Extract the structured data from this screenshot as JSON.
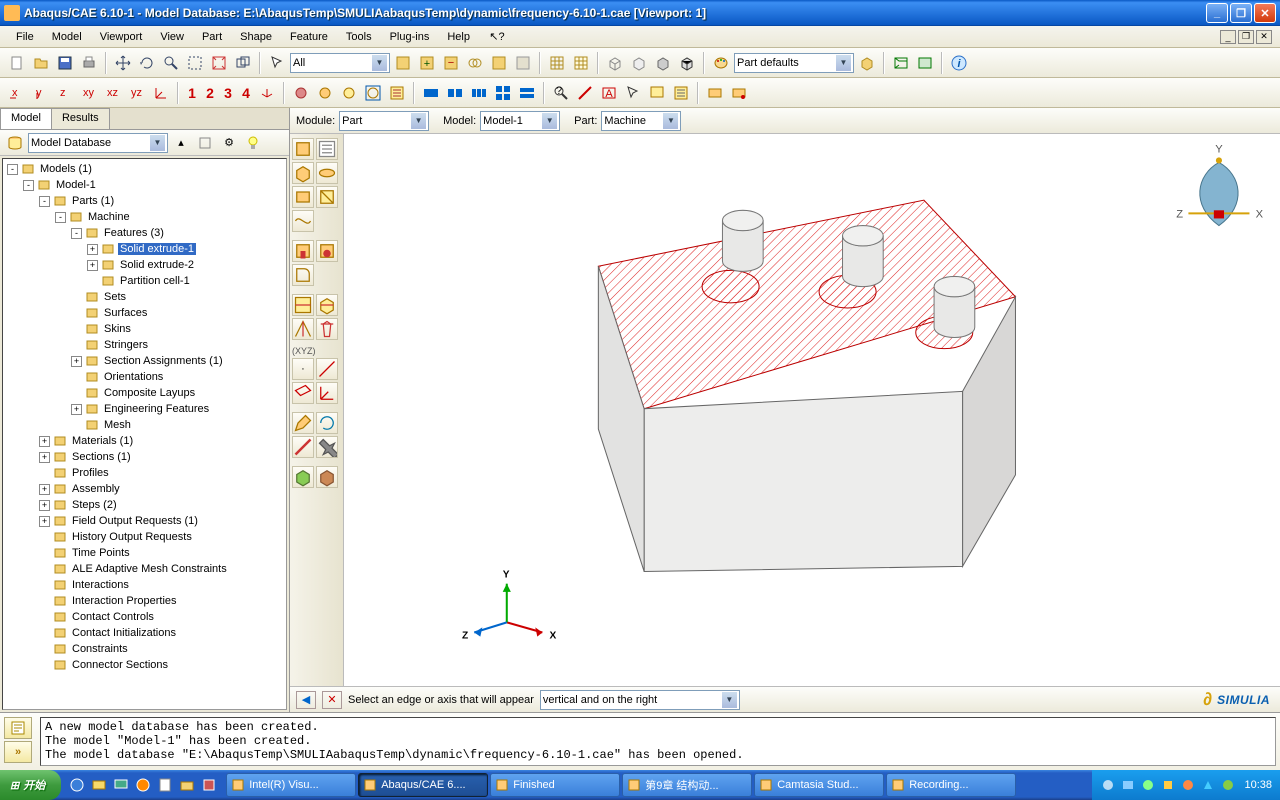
{
  "titlebar": {
    "text": "Abaqus/CAE 6.10-1 - Model Database: E:\\AbaqusTemp\\SMULIAabaqusTemp\\dynamic\\frequency-6.10-1.cae [Viewport: 1]"
  },
  "menubar": {
    "items": [
      "File",
      "Model",
      "Viewport",
      "View",
      "Part",
      "Shape",
      "Feature",
      "Tools",
      "Plug-ins",
      "Help"
    ]
  },
  "toolbar1": {
    "combo": "All",
    "combo2": "Part defaults"
  },
  "toolbar_numbers": [
    "1",
    "2",
    "3",
    "4"
  ],
  "panel_tabs": {
    "model": "Model",
    "results": "Results"
  },
  "panel_combo": "Model Database",
  "context": {
    "module_label": "Module:",
    "module": "Part",
    "model_label": "Model:",
    "model": "Model-1",
    "part_label": "Part:",
    "part": "Machine"
  },
  "tree": [
    {
      "d": 0,
      "e": "-",
      "i": "db",
      "t": "Models (1)"
    },
    {
      "d": 1,
      "e": "-",
      "i": "mdl",
      "t": "Model-1"
    },
    {
      "d": 2,
      "e": "-",
      "i": "parts",
      "t": "Parts (1)"
    },
    {
      "d": 3,
      "e": "-",
      "i": "part",
      "t": "Machine"
    },
    {
      "d": 4,
      "e": "-",
      "i": "feat",
      "t": "Features (3)"
    },
    {
      "d": 5,
      "e": "+",
      "i": "sol",
      "t": "Solid extrude-1",
      "sel": true
    },
    {
      "d": 5,
      "e": "+",
      "i": "sol",
      "t": "Solid extrude-2"
    },
    {
      "d": 5,
      "e": " ",
      "i": "par",
      "t": "Partition cell-1"
    },
    {
      "d": 4,
      "e": " ",
      "i": "set",
      "t": "Sets"
    },
    {
      "d": 4,
      "e": " ",
      "i": "srf",
      "t": "Surfaces"
    },
    {
      "d": 4,
      "e": " ",
      "i": "skn",
      "t": "Skins"
    },
    {
      "d": 4,
      "e": " ",
      "i": "str",
      "t": "Stringers"
    },
    {
      "d": 4,
      "e": "+",
      "i": "sec",
      "t": "Section Assignments (1)"
    },
    {
      "d": 4,
      "e": " ",
      "i": "ori",
      "t": "Orientations"
    },
    {
      "d": 4,
      "e": " ",
      "i": "cmp",
      "t": "Composite Layups"
    },
    {
      "d": 4,
      "e": "+",
      "i": "eng",
      "t": "Engineering Features"
    },
    {
      "d": 4,
      "e": " ",
      "i": "msh",
      "t": "Mesh"
    },
    {
      "d": 2,
      "e": "+",
      "i": "mat",
      "t": "Materials (1)"
    },
    {
      "d": 2,
      "e": "+",
      "i": "sct",
      "t": "Sections (1)"
    },
    {
      "d": 2,
      "e": " ",
      "i": "prf",
      "t": "Profiles"
    },
    {
      "d": 2,
      "e": "+",
      "i": "asm",
      "t": "Assembly"
    },
    {
      "d": 2,
      "e": "+",
      "i": "stp",
      "t": "Steps (2)"
    },
    {
      "d": 2,
      "e": "+",
      "i": "for",
      "t": "Field Output Requests (1)"
    },
    {
      "d": 2,
      "e": " ",
      "i": "hor",
      "t": "History Output Requests"
    },
    {
      "d": 2,
      "e": " ",
      "i": "tp",
      "t": "Time Points"
    },
    {
      "d": 2,
      "e": " ",
      "i": "ale",
      "t": "ALE Adaptive Mesh Constraints"
    },
    {
      "d": 2,
      "e": " ",
      "i": "int",
      "t": "Interactions"
    },
    {
      "d": 2,
      "e": " ",
      "i": "inp",
      "t": "Interaction Properties"
    },
    {
      "d": 2,
      "e": " ",
      "i": "cc",
      "t": "Contact Controls"
    },
    {
      "d": 2,
      "e": " ",
      "i": "ci",
      "t": "Contact Initializations"
    },
    {
      "d": 2,
      "e": " ",
      "i": "cns",
      "t": "Constraints"
    },
    {
      "d": 2,
      "e": " ",
      "i": "csn",
      "t": "Connector Sections"
    }
  ],
  "vt_label": "(XYZ)",
  "prompt": {
    "text": "Select an edge or axis that will appear",
    "combo": "vertical and on the right",
    "logo": "SIMULIA"
  },
  "triad": {
    "x": "X",
    "y": "Y",
    "z": "Z"
  },
  "messages": "A new model database has been created.\nThe model \"Model-1\" has been created.\nThe model database \"E:\\AbaqusTemp\\SMULIAabaqusTemp\\dynamic\\frequency-6.10-1.cae\" has been opened.",
  "taskbar": {
    "start": "开始",
    "tasks": [
      {
        "t": "Intel(R) Visu...",
        "a": false
      },
      {
        "t": "Abaqus/CAE 6....",
        "a": true
      },
      {
        "t": "Finished",
        "a": false
      },
      {
        "t": "第9章 结构动...",
        "a": false
      },
      {
        "t": "Camtasia Stud...",
        "a": false
      },
      {
        "t": "Recording...",
        "a": false
      }
    ],
    "clock": "10:38"
  }
}
